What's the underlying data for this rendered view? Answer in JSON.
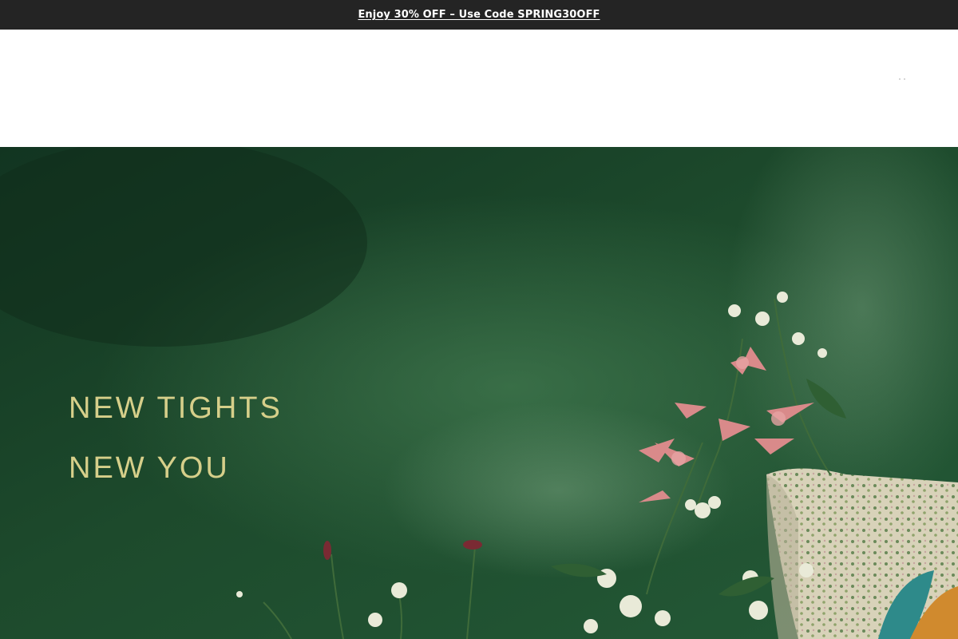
{
  "announcement": {
    "text": "Enjoy 30% OFF – Use Code SPRING30OFF"
  },
  "hero": {
    "headline_line1": "NEW TIGHTS",
    "headline_line2": "NEW YOU"
  },
  "colors": {
    "announcement_bg": "#242424",
    "hero_bg": "#1f4a2e",
    "headline_text": "#d6cf8a"
  },
  "icons": {
    "header_menu": "more-dots-icon"
  }
}
